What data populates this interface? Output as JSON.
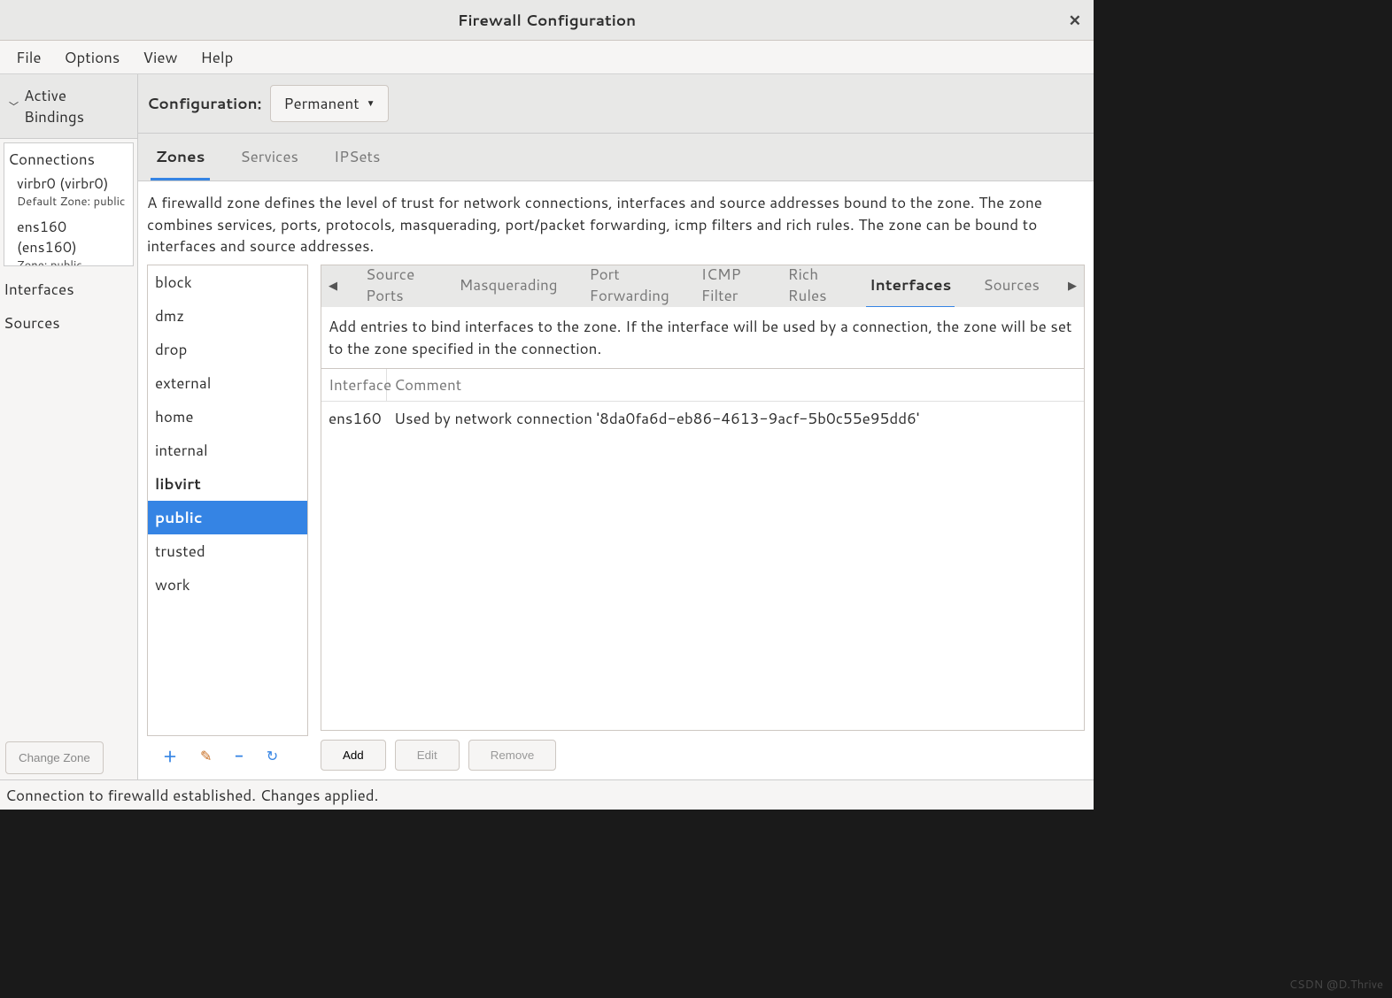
{
  "title": "Firewall Configuration",
  "menubar": [
    "File",
    "Options",
    "View",
    "Help"
  ],
  "sidebar": {
    "header": "Active Bindings",
    "connections": {
      "title": "Connections",
      "items": [
        {
          "name": "virbr0 (virbr0)",
          "sub": "Default Zone: public"
        },
        {
          "name": "ens160 (ens160)",
          "sub": "Zone: public"
        }
      ]
    },
    "interfaces_label": "Interfaces",
    "sources_label": "Sources",
    "change_zone": "Change Zone"
  },
  "toolbar": {
    "label": "Configuration:",
    "selected": "Permanent"
  },
  "tabs": {
    "items": [
      "Zones",
      "Services",
      "IPSets"
    ],
    "active": 0
  },
  "zone_desc": "A firewalld zone defines the level of trust for network connections, interfaces and source addresses bound to the zone. The zone combines services, ports, protocols, masquerading, port/packet forwarding, icmp filters and rich rules. The zone can be bound to interfaces and source addresses.",
  "zones": {
    "items": [
      "block",
      "dmz",
      "drop",
      "external",
      "home",
      "internal",
      "libvirt",
      "public",
      "trusted",
      "work"
    ],
    "bold": [
      "libvirt",
      "public"
    ],
    "selected": "public"
  },
  "subtabs": {
    "items": [
      "Source Ports",
      "Masquerading",
      "Port Forwarding",
      "ICMP Filter",
      "Rich Rules",
      "Interfaces",
      "Sources"
    ],
    "active": 5
  },
  "detail_desc": "Add entries to bind interfaces to the zone. If the interface will be used by a connection, the zone will be set to the zone specified in the connection.",
  "iface_table": {
    "headers": [
      "Interface",
      "Comment"
    ],
    "rows": [
      {
        "interface": "ens160",
        "comment": "Used by network connection '8da0fa6d-eb86-4613-9acf-5b0c55e95dd6'"
      }
    ]
  },
  "buttons": {
    "add": "Add",
    "edit": "Edit",
    "remove": "Remove"
  },
  "status": "Connection to firewalld established.  Changes applied.",
  "watermark": "CSDN @D.Thrive"
}
